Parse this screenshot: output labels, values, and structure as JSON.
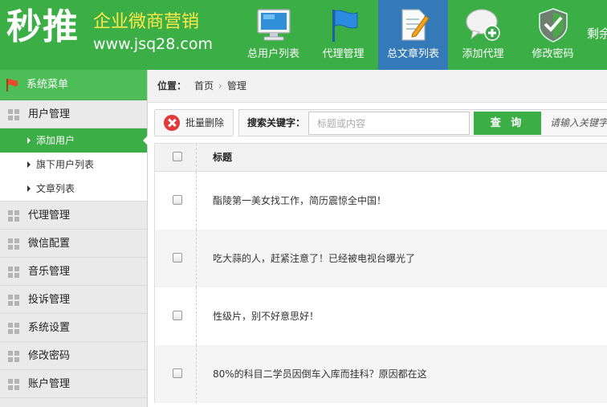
{
  "header": {
    "logo_main": "秒推",
    "logo_slogan": "企业微商营销",
    "logo_url": "www.jsq28.com",
    "nav": [
      {
        "label": "总用户列表",
        "icon": "monitor-icon",
        "active": false
      },
      {
        "label": "代理管理",
        "icon": "flag-icon",
        "active": false
      },
      {
        "label": "总文章列表",
        "icon": "document-pencil-icon",
        "active": true
      },
      {
        "label": "添加代理",
        "icon": "chat-add-icon",
        "active": false
      },
      {
        "label": "修改密码",
        "icon": "shield-check-icon",
        "active": false
      }
    ],
    "remain_text": "剩余"
  },
  "sidebar": {
    "title": "系统菜单",
    "groups": [
      {
        "label": "用户管理",
        "items": [
          {
            "label": "添加用户",
            "active": true
          },
          {
            "label": "旗下用户列表",
            "active": false
          },
          {
            "label": "文章列表",
            "active": false
          }
        ]
      },
      {
        "label": "代理管理"
      },
      {
        "label": "微信配置"
      },
      {
        "label": "音乐管理"
      },
      {
        "label": "投诉管理"
      },
      {
        "label": "系统设置"
      },
      {
        "label": "修改密码"
      },
      {
        "label": "账户管理"
      }
    ]
  },
  "breadcrumb": {
    "label": "位置：",
    "items": [
      "首页",
      "管理"
    ]
  },
  "toolbar": {
    "delete_label": "批量删除",
    "search_label": "搜索关键字：",
    "search_placeholder": "标题或内容",
    "search_button": "查 询",
    "search_hint": "请输入关键字"
  },
  "table": {
    "header_title": "标题",
    "rows": [
      "酯陵第一美女找工作，简历震惊全中国！",
      "吃大蒜的人，赶紧注意了！已经被电视台曝光了",
      "性级片，别不好意思好！",
      "80%的科目二学员因倒车入库而挂科？原因都在这"
    ]
  },
  "colors": {
    "brand_green": "#3bae45",
    "active_blue": "#3479b8",
    "logo_yellow": "#ffe94a"
  }
}
